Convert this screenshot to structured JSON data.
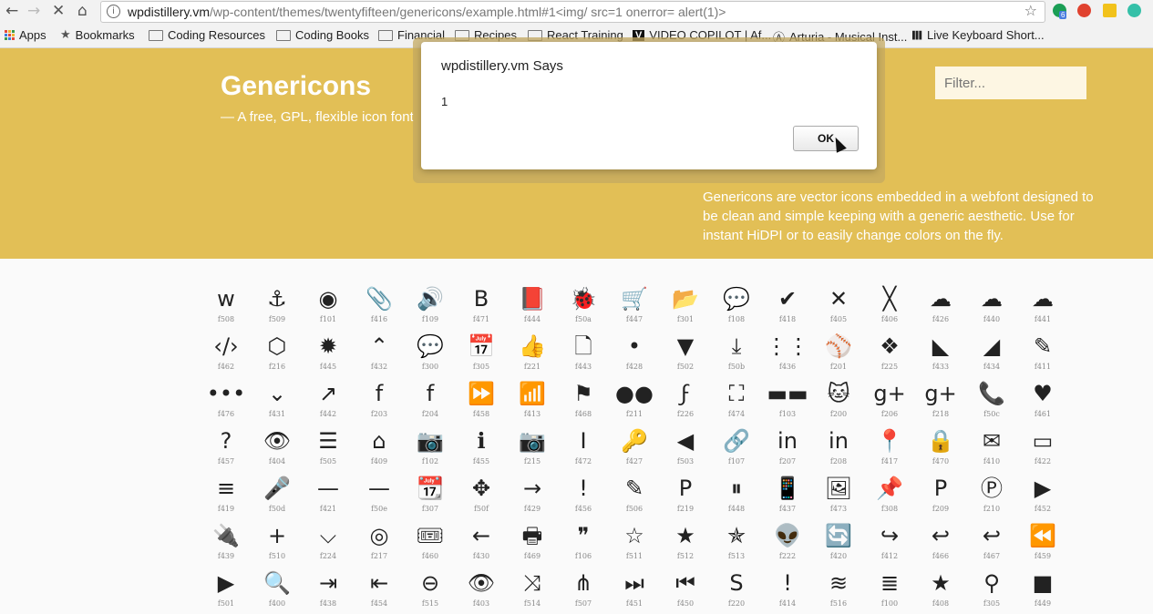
{
  "browser": {
    "url_host": "wpdistillery.vm",
    "url_path": "/wp-content/themes/twentyfifteen/genericons/example.html#1<img/ src=1 onerror= alert(1)>",
    "extension_badge": "6"
  },
  "bookmarks": [
    {
      "label": "Apps",
      "icon": "apps-grid-icon"
    },
    {
      "label": "Bookmarks",
      "icon": "star-icon"
    },
    {
      "label": "Coding Resources",
      "icon": "folder-icon"
    },
    {
      "label": "Coding Books",
      "icon": "folder-icon"
    },
    {
      "label": "Financial",
      "icon": "folder-icon"
    },
    {
      "label": "Recipes",
      "icon": "folder-icon"
    },
    {
      "label": "React Training",
      "icon": "folder-icon"
    },
    {
      "label": "VIDEO COPILOT | Af...",
      "icon": "videocopilot-icon"
    },
    {
      "label": "Arturia - Musical Inst...",
      "icon": "arturia-icon"
    },
    {
      "label": "Live Keyboard Short...",
      "icon": "barcode-icon"
    }
  ],
  "header": {
    "title": "Genericons",
    "tagline": "— A free, GPL, flexible icon font",
    "filter_placeholder": "Filter...",
    "description": "Genericons are vector icons embedded in a webfont designed to be clean and simple keeping with a generic aesthetic. Use for instant HiDPI or to easily change colors on the fly.",
    "accent_color": "#e2bf56"
  },
  "dialog": {
    "title": "wpdistillery.vm Says",
    "message": "1",
    "ok_label": "OK"
  },
  "icons": [
    [
      "f508",
      "ᴡ"
    ],
    [
      "f509",
      "⚓"
    ],
    [
      "f101",
      "◉"
    ],
    [
      "f416",
      "📎"
    ],
    [
      "f109",
      "🔊"
    ],
    [
      "f471",
      "B"
    ],
    [
      "f444",
      "📕"
    ],
    [
      "f50a",
      "🐞"
    ],
    [
      "f447",
      "🛒"
    ],
    [
      "f301",
      "📂"
    ],
    [
      "f108",
      "💬"
    ],
    [
      "f418",
      "✔"
    ],
    [
      "f405",
      "✕"
    ],
    [
      "f406",
      "╳"
    ],
    [
      "f426",
      "☁"
    ],
    [
      "f440",
      "☁"
    ],
    [
      "f441",
      "☁"
    ],
    [
      "f462",
      "‹/›"
    ],
    [
      "f216",
      "⬡"
    ],
    [
      "f445",
      "✹"
    ],
    [
      "f432",
      "⌃"
    ],
    [
      "f300",
      "💬"
    ],
    [
      "f305",
      "📅"
    ],
    [
      "f221",
      "👍"
    ],
    [
      "f443",
      "🗋"
    ],
    [
      "f428",
      "•"
    ],
    [
      "f502",
      "▼"
    ],
    [
      "f50b",
      "⤓"
    ],
    [
      "f436",
      "⋮⋮"
    ],
    [
      "f201",
      "⚾"
    ],
    [
      "f225",
      "❖"
    ],
    [
      "f433",
      "◣"
    ],
    [
      "f434",
      "◢"
    ],
    [
      "f411",
      "✎"
    ],
    [
      "f476",
      "•••"
    ],
    [
      "f431",
      "⌄"
    ],
    [
      "f442",
      "↗"
    ],
    [
      "f203",
      "f"
    ],
    [
      "f204",
      "f"
    ],
    [
      "f458",
      "⏩"
    ],
    [
      "f413",
      "📶"
    ],
    [
      "f468",
      "⚑"
    ],
    [
      "f211",
      "●●"
    ],
    [
      "f226",
      "ϝ"
    ],
    [
      "f474",
      "⛶"
    ],
    [
      "f103",
      "▬▬"
    ],
    [
      "f200",
      "🐱"
    ],
    [
      "f206",
      "g+"
    ],
    [
      "f218",
      "g+"
    ],
    [
      "f50c",
      "📞"
    ],
    [
      "f461",
      "♥"
    ],
    [
      "f457",
      "?"
    ],
    [
      "f404",
      "👁"
    ],
    [
      "f505",
      "☰"
    ],
    [
      "f409",
      "⌂"
    ],
    [
      "f102",
      "📷"
    ],
    [
      "f455",
      "ℹ"
    ],
    [
      "f215",
      "📷"
    ],
    [
      "f472",
      "I"
    ],
    [
      "f427",
      "🔑"
    ],
    [
      "f503",
      "◀"
    ],
    [
      "f107",
      "🔗"
    ],
    [
      "f207",
      "in"
    ],
    [
      "f208",
      "in"
    ],
    [
      "f417",
      "📍"
    ],
    [
      "f470",
      "🔒"
    ],
    [
      "f410",
      "✉"
    ],
    [
      "f422",
      "▭"
    ],
    [
      "f419",
      "≡"
    ],
    [
      "f50d",
      "🎤"
    ],
    [
      "f421",
      "—"
    ],
    [
      "f50e",
      "—"
    ],
    [
      "f307",
      "📆"
    ],
    [
      "f50f",
      "✥"
    ],
    [
      "f429",
      "→"
    ],
    [
      "f456",
      "!"
    ],
    [
      "f506",
      "✎"
    ],
    [
      "f219",
      "P"
    ],
    [
      "f448",
      "⏸"
    ],
    [
      "f437",
      "📱"
    ],
    [
      "f473",
      "🖼"
    ],
    [
      "f308",
      "📌"
    ],
    [
      "f209",
      "P"
    ],
    [
      "f210",
      "Ⓟ"
    ],
    [
      "f452",
      "▶"
    ],
    [
      "f439",
      "🔌"
    ],
    [
      "f510",
      "+"
    ],
    [
      "f224",
      "⌵"
    ],
    [
      "f217",
      "◎"
    ],
    [
      "f460",
      "🎟"
    ],
    [
      "f430",
      "←"
    ],
    [
      "f469",
      "🖶"
    ],
    [
      "f106",
      "❞"
    ],
    [
      "f511",
      "☆"
    ],
    [
      "f512",
      "★"
    ],
    [
      "f513",
      "✯"
    ],
    [
      "f222",
      "👽"
    ],
    [
      "f420",
      "🔄"
    ],
    [
      "f412",
      "↪"
    ],
    [
      "f466",
      "↩"
    ],
    [
      "f467",
      "↩"
    ],
    [
      "f459",
      "⏪"
    ],
    [
      "f501",
      "▶"
    ],
    [
      "f400",
      "🔍"
    ],
    [
      "f438",
      "⇥"
    ],
    [
      "f454",
      "⇤"
    ],
    [
      "f515",
      "⊖"
    ],
    [
      "f403",
      "👁"
    ],
    [
      "f514",
      "⤨"
    ],
    [
      "f507",
      "⋔"
    ],
    [
      "f451",
      "⏭"
    ],
    [
      "f450",
      "⏮"
    ],
    [
      "f220",
      "S"
    ],
    [
      "f414",
      "!"
    ],
    [
      "f516",
      "≋"
    ],
    [
      "f100",
      "≣"
    ],
    [
      "f408",
      "★"
    ],
    [
      "f305",
      "⚲"
    ],
    [
      "f449",
      "■"
    ]
  ]
}
